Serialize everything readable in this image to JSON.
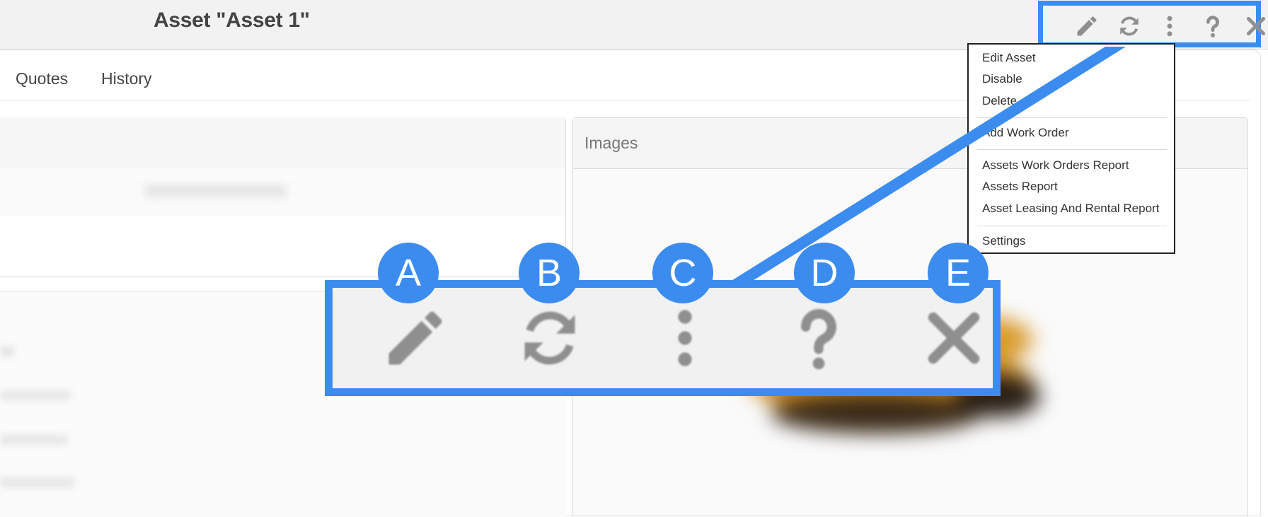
{
  "header": {
    "title": "Asset \"Asset 1\""
  },
  "toolbar_icons": [
    "pencil-icon",
    "refresh-icon",
    "more-vert-icon",
    "help-icon",
    "close-icon"
  ],
  "tabs": [
    {
      "label": "Quotes"
    },
    {
      "label": "History"
    }
  ],
  "images_panel": {
    "title": "Images"
  },
  "dropdown": {
    "groups": [
      [
        "Edit Asset",
        "Disable",
        "Delete"
      ],
      [
        "Add Work Order"
      ],
      [
        "Assets Work Orders Report",
        "Assets Report",
        "Asset Leasing And Rental Report"
      ],
      [
        "Settings"
      ]
    ]
  },
  "callout": {
    "badges": [
      "A",
      "B",
      "C",
      "D",
      "E"
    ],
    "accent_color": "#3c8cf0",
    "icon_color": "#8f8f8f"
  }
}
